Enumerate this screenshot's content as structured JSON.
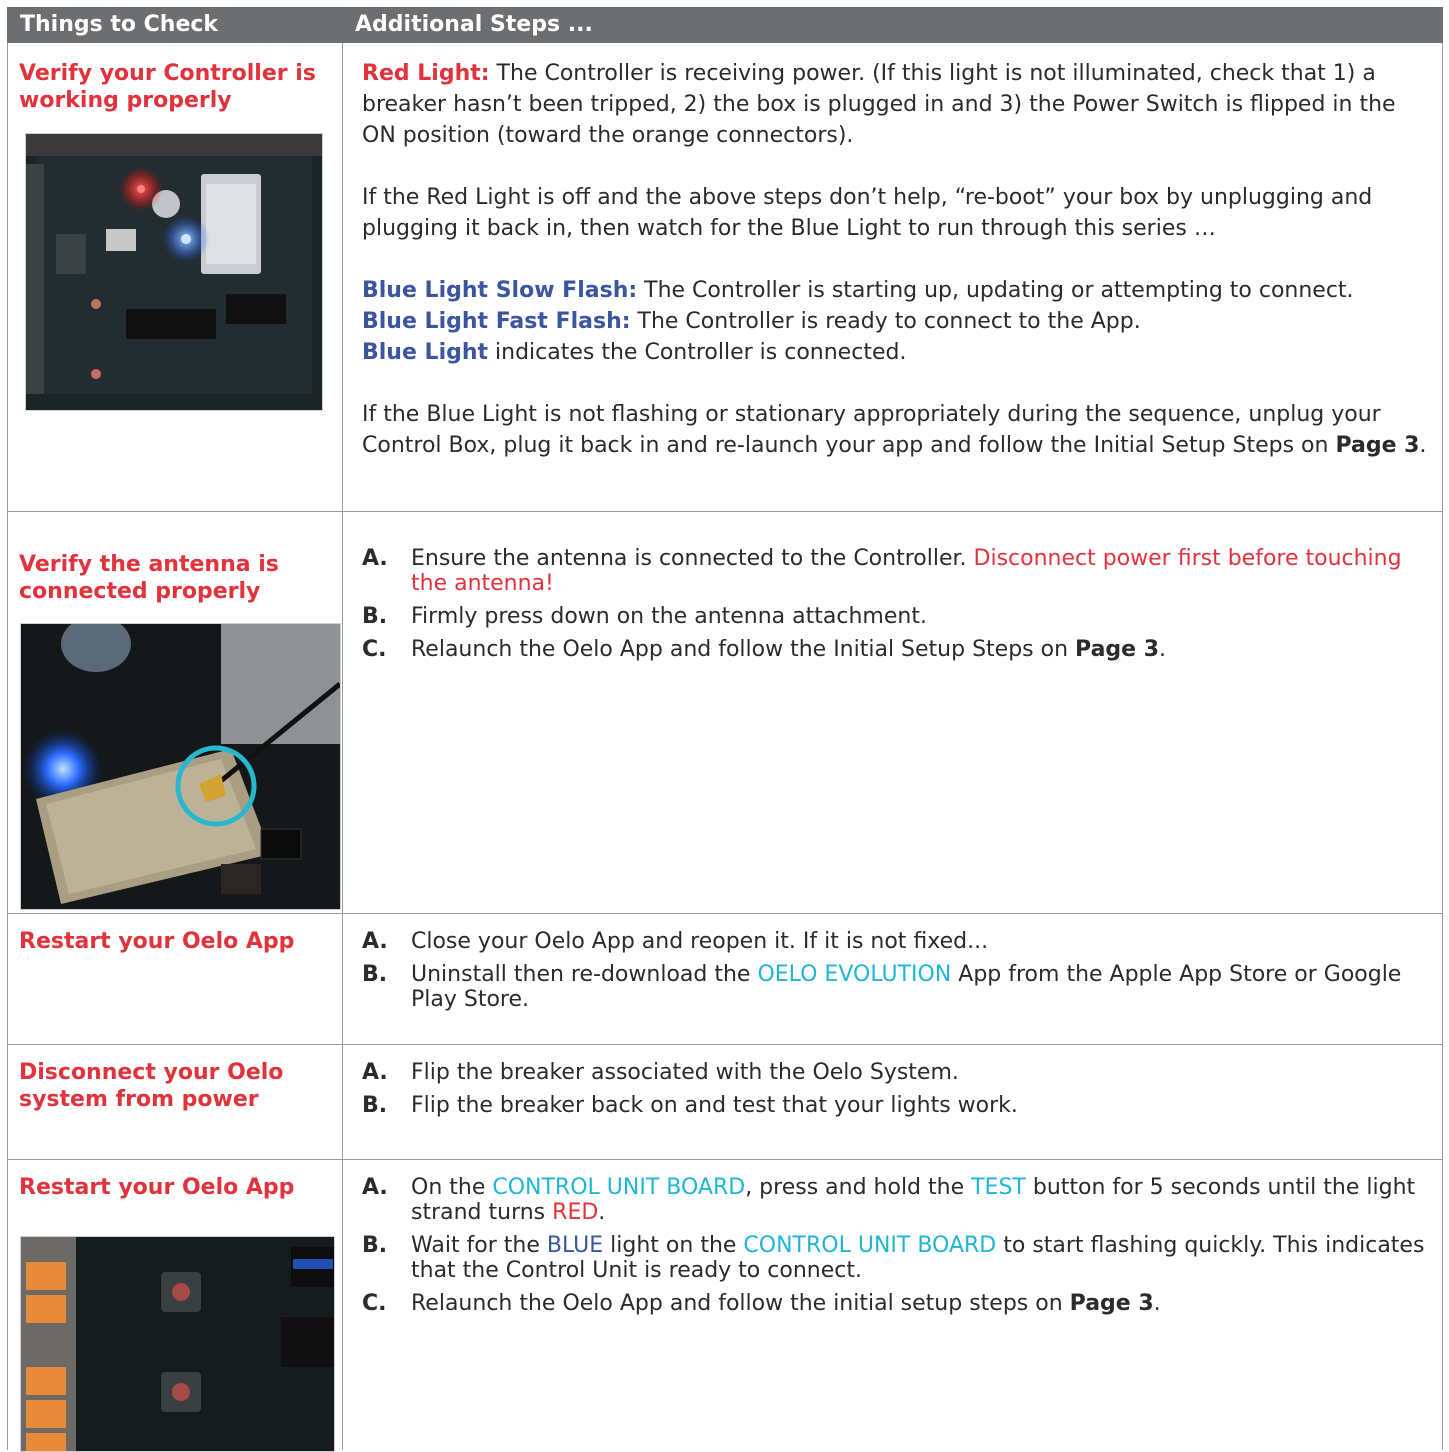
{
  "header": {
    "col1": "Things to Check",
    "col2": "Additional Steps ..."
  },
  "rows": [
    {
      "check": "Verify your Controller is working properly",
      "red_light_label": "Red Light:",
      "red_light_text": " The Controller is receiving power. (If this light is not illuminated, check that 1) a breaker hasn’t been tripped, 2) the box is plugged in and 3) the Power Switch is flipped in the ON position (toward the orange connectors).",
      "reboot_text": "If the Red Light is off and the above steps don’t help, “re-boot” your box by unplugging and plugging it back in, then watch for the Blue Light to run through this series …",
      "slow_label": "Blue Light Slow Flash:",
      "slow_text": " The Controller is starting up, updating or attempting to connect.",
      "fast_label": "Blue Light Fast Flash:",
      "fast_text": " The Controller is ready to connect to the App.",
      "solid_label": "Blue Light",
      "solid_text": " indicates the Controller is connected.",
      "final_text": "If the Blue Light is not flashing or stationary appropriately during the sequence, unplug your Control Box, plug it back in and re-launch your app and follow the Initial Setup Steps on ",
      "final_page": "Page 3",
      "final_end": "."
    },
    {
      "check": "Verify the antenna is connected properly",
      "a_marker": "A.",
      "a_text": "Ensure the antenna is connected to the Controller. ",
      "a_warning": "Disconnect power first before touching the antenna!",
      "b_marker": "B.",
      "b_text": "Firmly press down on the antenna attachment.",
      "c_marker": "C.",
      "c_text": "Relaunch the Oelo App and follow the Initial Setup Steps on ",
      "c_page": "Page 3",
      "c_end": "."
    },
    {
      "check": "Restart your Oelo App",
      "a_marker": "A.",
      "a_text": "Close your Oelo App and reopen it. If it is not fixed...",
      "b_marker": "B.",
      "b_text1": "Uninstall then re-download the ",
      "b_highlight": "OELO EVOLUTION",
      "b_text2": " App from the Apple App Store or Google Play Store."
    },
    {
      "check": "Disconnect your Oelo system from power",
      "a_marker": "A.",
      "a_text": "Flip the breaker associated with the Oelo System.",
      "b_marker": "B.",
      "b_text": "Flip the breaker back on and test that your lights work."
    },
    {
      "check": "Restart your Oelo App",
      "a_marker": "A.",
      "a_t1": "On the ",
      "a_board": "CONTROL UNIT BOARD",
      "a_t2": ", press and hold the ",
      "a_test": "TEST",
      "a_t3": " button for 5 seconds until the light strand turns ",
      "a_red": "RED",
      "a_t4": ".",
      "b_marker": "B.",
      "b_t1": "Wait for the ",
      "b_blue": "BLUE",
      "b_t2": " light on the ",
      "b_board": "CONTROL UNIT BOARD",
      "b_t3": " to start flashing quickly. This indicates that the Control Unit is ready to connect.",
      "c_marker": "C.",
      "c_text": "Relaunch the Oelo App and follow the initial setup steps on ",
      "c_page": "Page 3",
      "c_end": "."
    }
  ],
  "colors": {
    "header_bg": "#6d6e71",
    "red": "#e2323c",
    "blue": "#3c55a1",
    "cyan": "#1fb6d5"
  },
  "icons": [
    "controller-board-photo",
    "antenna-photo",
    "test-button-photo"
  ]
}
